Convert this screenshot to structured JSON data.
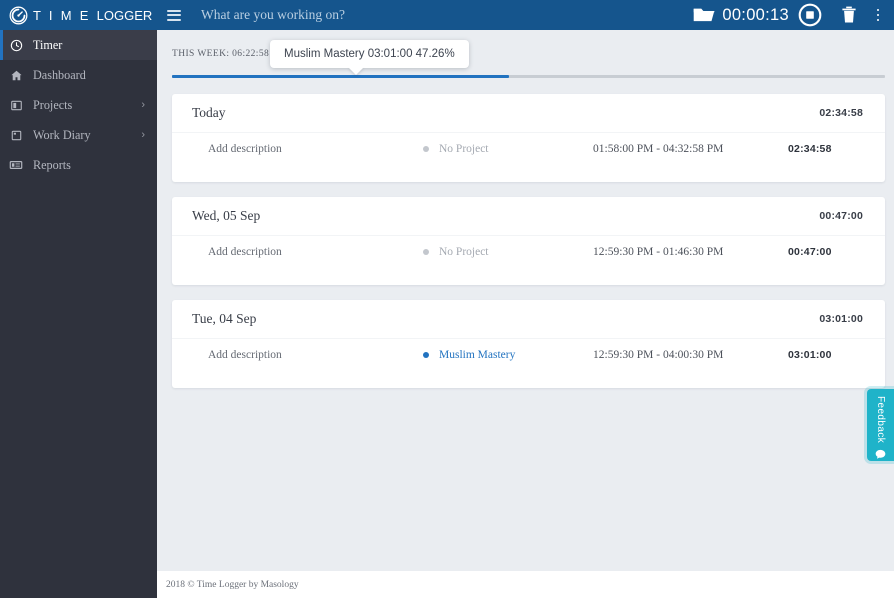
{
  "brand": {
    "logo_icon": "clock-gauge-icon",
    "name_part1": "T I M E ",
    "name_part2": "LOGGER"
  },
  "topbar": {
    "menu_icon": "hamburger-menu-icon",
    "task_input_value": "",
    "task_input_placeholder": "What are you working on?",
    "folder_icon": "folder-icon",
    "timer_value": "00:00:13",
    "stop_icon": "stop-button-icon",
    "delete_icon": "trash-icon",
    "more_icon": "vertical-dots-icon",
    "bg_color": "#15558d"
  },
  "sidebar": {
    "bg_color": "#2f323d",
    "active_accent": "#2273c0",
    "items": [
      {
        "label": "Timer",
        "icon": "clock-icon",
        "active": true,
        "chevron": ""
      },
      {
        "label": "Dashboard",
        "icon": "home-icon",
        "active": false,
        "chevron": ""
      },
      {
        "label": "Projects",
        "icon": "book-icon",
        "active": false,
        "chevron": "›"
      },
      {
        "label": "Work Diary",
        "icon": "notebook-icon",
        "active": false,
        "chevron": "›"
      },
      {
        "label": "Reports",
        "icon": "id-card-icon",
        "active": false,
        "chevron": ""
      }
    ]
  },
  "week_summary": {
    "label": "THIS WEEK: 06:22:58",
    "caret_icon": "chevron-down-icon",
    "progress_percent": 47.26,
    "progress_color": "#2273c0",
    "track_color": "#c8cdd3",
    "tooltip_text": "Muslim Mastery 03:01:00 47.26%"
  },
  "days": [
    {
      "date": "Today",
      "total": "02:34:58",
      "entries": [
        {
          "description": "Add description",
          "project": "No Project",
          "project_assigned": false,
          "dot_color": "#c3c7cd",
          "time_range": "01:58:00 PM - 04:32:58 PM",
          "duration": "02:34:58"
        }
      ]
    },
    {
      "date": "Wed, 05 Sep",
      "total": "00:47:00",
      "entries": [
        {
          "description": "Add description",
          "project": "No Project",
          "project_assigned": false,
          "dot_color": "#c3c7cd",
          "time_range": "12:59:30 PM - 01:46:30 PM",
          "duration": "00:47:00"
        }
      ]
    },
    {
      "date": "Tue, 04 Sep",
      "total": "03:01:00",
      "entries": [
        {
          "description": "Add description",
          "project": "Muslim Mastery",
          "project_assigned": true,
          "dot_color": "#2273c0",
          "time_range": "12:59:30 PM - 04:00:30 PM",
          "duration": "03:01:00"
        }
      ]
    }
  ],
  "feedback": {
    "label": "Feedback",
    "icon": "chat-bubble-icon",
    "color": "#1fb3c9"
  },
  "footer": {
    "text": "2018 © Time Logger by Masology"
  }
}
